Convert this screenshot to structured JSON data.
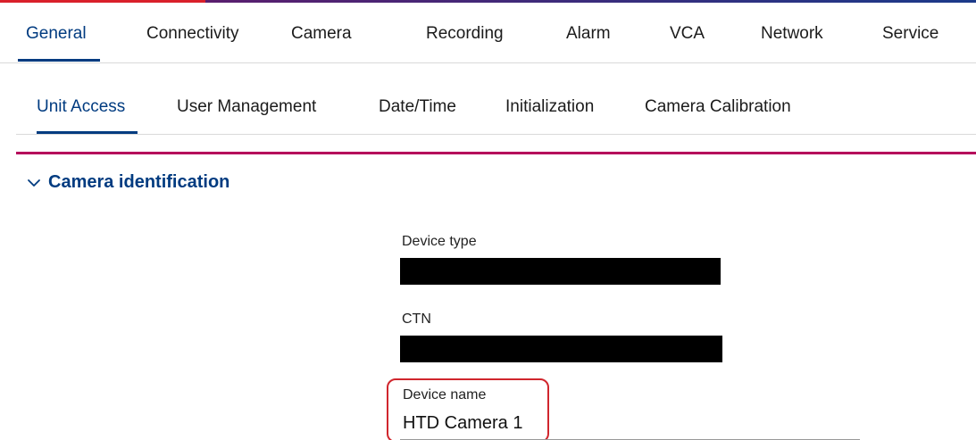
{
  "main_tabs": [
    {
      "label": "General",
      "active": true
    },
    {
      "label": "Connectivity",
      "active": false
    },
    {
      "label": "Camera",
      "active": false
    },
    {
      "label": "Recording",
      "active": false
    },
    {
      "label": "Alarm",
      "active": false
    },
    {
      "label": "VCA",
      "active": false
    },
    {
      "label": "Network",
      "active": false
    },
    {
      "label": "Service",
      "active": false
    }
  ],
  "sub_tabs": [
    {
      "label": "Unit Access",
      "active": true
    },
    {
      "label": "User Management",
      "active": false
    },
    {
      "label": "Date/Time",
      "active": false
    },
    {
      "label": "Initialization",
      "active": false
    },
    {
      "label": "Camera Calibration",
      "active": false
    }
  ],
  "section": {
    "title": "Camera identification",
    "expanded": true,
    "icon": "chevron-down-icon"
  },
  "fields": {
    "device_type": {
      "label": "Device type",
      "value_redacted": true
    },
    "ctn": {
      "label": "CTN",
      "value_redacted": true
    },
    "device_name": {
      "label": "Device name",
      "value": "HTD Camera 1",
      "highlighted": true
    }
  },
  "colors": {
    "accent_blue": "#003b80",
    "magenta_rule": "#b5005b",
    "highlight_red": "#d0262d"
  }
}
